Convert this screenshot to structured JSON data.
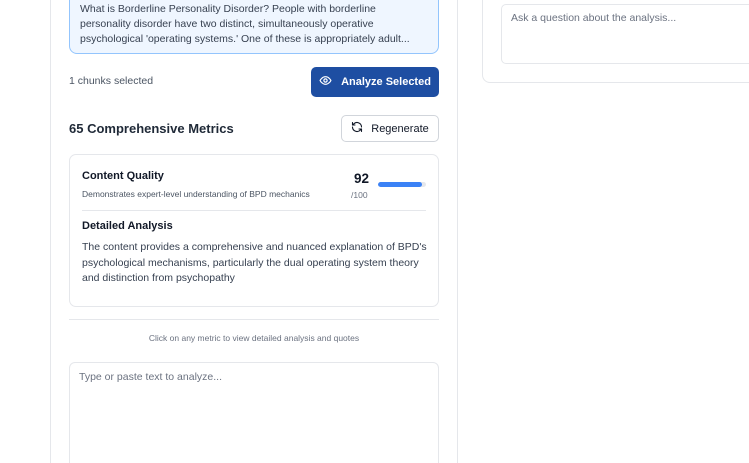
{
  "chunk": {
    "text": "What is Borderline Personality Disorder? People with borderline personality disorder have two distinct, simultaneously operative psychological 'operating systems.' One of these is appropriately adult..."
  },
  "selection": {
    "count_label": "1 chunks selected",
    "analyze_label": "Analyze Selected"
  },
  "metrics": {
    "title": "65 Comprehensive Metrics",
    "regenerate_label": "Regenerate",
    "items": [
      {
        "name": "Content Quality",
        "description": "Demonstrates expert-level understanding of BPD mechanics",
        "score": "92",
        "max": "/100",
        "score_fraction": 0.92,
        "analysis_heading": "Detailed Analysis",
        "analysis_text": "The content provides a comprehensive and nuanced explanation of BPD's psychological mechanisms, particularly the dual operating system theory and distinction from psychopathy"
      }
    ],
    "hint": "Click on any metric to view detailed analysis and quotes"
  },
  "editor": {
    "placeholder": "Type or paste text to analyze..."
  },
  "chat": {
    "placeholder": "Ask a question about the analysis..."
  },
  "colors": {
    "accent": "#1e4ea2",
    "progress": "#3b82f6",
    "chunk_bg": "#eff6ff",
    "chunk_border": "#93c5fd"
  },
  "icons": {
    "analyze": "eye-icon",
    "regenerate": "refresh-icon"
  }
}
